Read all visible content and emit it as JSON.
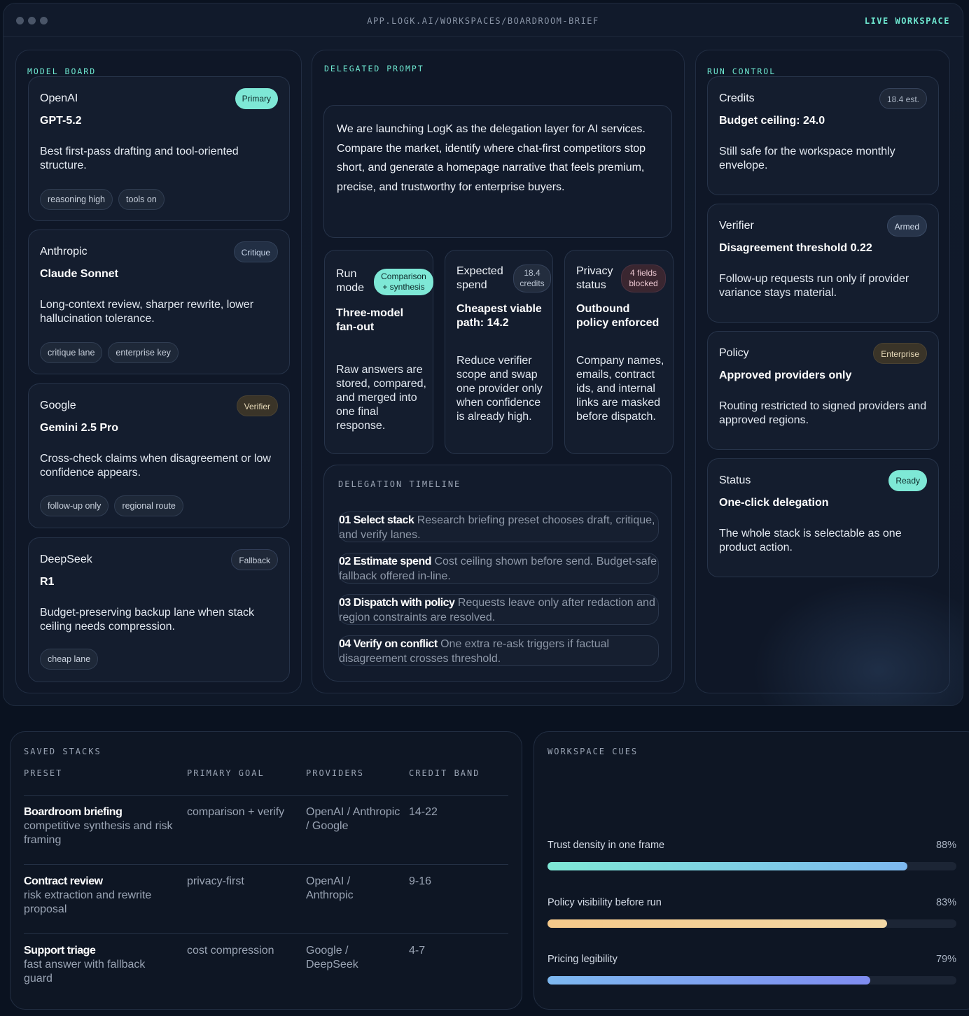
{
  "window": {
    "url": "APP.LOGK.AI/WORKSPACES/BOARDROOM-BRIEF",
    "status": "LIVE WORKSPACE"
  },
  "model_board": {
    "label": "MODEL BOARD",
    "cards": [
      {
        "provider": "OpenAI",
        "badge": "Primary",
        "model": "GPT-5.2",
        "desc": "Best first-pass drafting and tool-oriented structure.",
        "chips": [
          "reasoning high",
          "tools on"
        ]
      },
      {
        "provider": "Anthropic",
        "badge": "Critique",
        "model": "Claude Sonnet",
        "desc": "Long-context review, sharper rewrite, lower hallucination tolerance.",
        "chips": [
          "critique lane",
          "enterprise key"
        ]
      },
      {
        "provider": "Google",
        "badge": "Verifier",
        "model": "Gemini 2.5 Pro",
        "desc": "Cross-check claims when disagreement or low confidence appears.",
        "chips": [
          "follow-up only",
          "regional route"
        ]
      },
      {
        "provider": "DeepSeek",
        "badge": "Fallback",
        "model": "R1",
        "desc": "Budget-preserving backup lane when stack ceiling needs compression.",
        "chips": [
          "cheap lane"
        ]
      }
    ]
  },
  "delegated_prompt": {
    "label": "DELEGATED PROMPT",
    "text": "We are launching LogK as the delegation layer for AI services. Compare the market, identify where chat-first competitors stop short, and generate a homepage narrative that feels premium, precise, and trustworthy for enterprise buyers.",
    "minis": [
      {
        "head": "Run mode",
        "badge": "Comparison + synthesis",
        "title": "Three-model fan-out",
        "desc": "Raw answers are stored, compared, and merged into one final response."
      },
      {
        "head": "Expected spend",
        "badge": "18.4 credits",
        "title": "Cheapest viable path: 14.2",
        "desc": "Reduce verifier scope and swap one provider only when confidence is already high."
      },
      {
        "head": "Privacy status",
        "badge": "4 fields blocked",
        "title": "Outbound policy enforced",
        "desc": "Company names, emails, contract ids, and internal links are masked before dispatch."
      }
    ],
    "timeline": {
      "label": "DELEGATION TIMELINE",
      "items": [
        {
          "step": "01 Select stack",
          "text": "Research briefing preset chooses draft, critique, and verify lanes."
        },
        {
          "step": "02 Estimate spend",
          "text": "Cost ceiling shown before send. Budget-safe fallback offered in-line."
        },
        {
          "step": "03 Dispatch with policy",
          "text": "Requests leave only after redaction and region constraints are resolved."
        },
        {
          "step": "04 Verify on conflict",
          "text": "One extra re-ask triggers if factual disagreement crosses threshold."
        }
      ]
    }
  },
  "run_control": {
    "label": "RUN CONTROL",
    "cards": [
      {
        "head": "Credits",
        "badge": "18.4 est.",
        "title": "Budget ceiling: 24.0",
        "desc": "Still safe for the workspace monthly envelope."
      },
      {
        "head": "Verifier",
        "badge": "Armed",
        "title": "Disagreement threshold 0.22",
        "desc": "Follow-up requests run only if provider variance stays material."
      },
      {
        "head": "Policy",
        "badge": "Enterprise",
        "title": "Approved providers only",
        "desc": "Routing restricted to signed providers and approved regions."
      },
      {
        "head": "Status",
        "badge": "Ready",
        "title": "One-click delegation",
        "desc": "The whole stack is selectable as one product action."
      }
    ]
  },
  "saved_stacks": {
    "label": "SAVED STACKS",
    "columns": [
      "PRESET",
      "PRIMARY GOAL",
      "PROVIDERS",
      "CREDIT BAND"
    ],
    "rows": [
      {
        "name": "Boardroom briefing",
        "sub": "competitive synthesis and risk framing",
        "goal": "comparison + verify",
        "providers": "OpenAI / Anthropic / Google",
        "band": "14-22"
      },
      {
        "name": "Contract review",
        "sub": "risk extraction and rewrite proposal",
        "goal": "privacy-first",
        "providers": "OpenAI / Anthropic",
        "band": "9-16"
      },
      {
        "name": "Support triage",
        "sub": "fast answer with fallback guard",
        "goal": "cost compression",
        "providers": "Google / DeepSeek",
        "band": "4-7"
      }
    ]
  },
  "workspace_cues": {
    "label": "WORKSPACE CUES",
    "metrics": [
      {
        "label": "Trust density in one frame",
        "value": "88%",
        "fraction": 0.88
      },
      {
        "label": "Policy visibility before run",
        "value": "83%",
        "fraction": 0.83
      },
      {
        "label": "Pricing legibility",
        "value": "79%",
        "fraction": 0.79
      }
    ]
  },
  "colors": {
    "accent": "#6ee7d0",
    "bar_trust": "#7ee8d6",
    "bar_policy": "#f5c98a",
    "bar_pricing": "#7f8cf0"
  }
}
